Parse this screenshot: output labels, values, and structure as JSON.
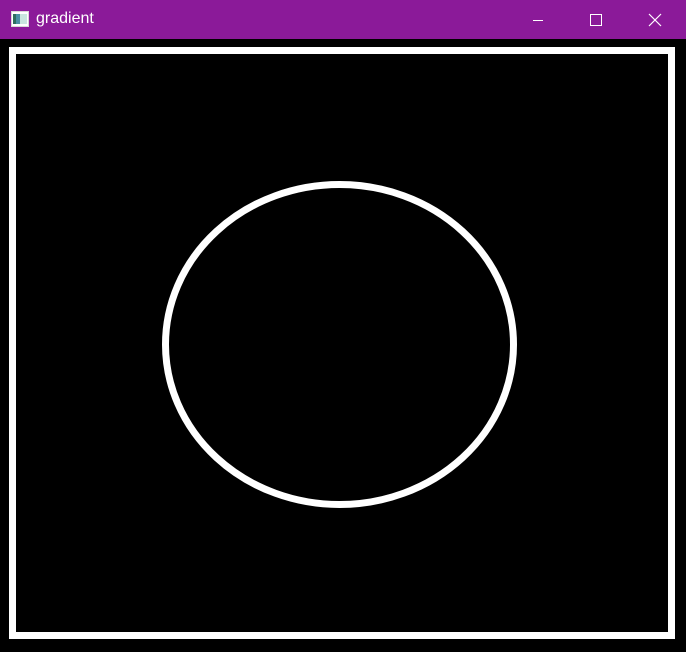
{
  "window": {
    "title": "gradient",
    "icon": "opencv-window-icon",
    "titlebar_color": "#8b1a99",
    "controls": {
      "minimize_icon": "minimize-icon",
      "maximize_icon": "maximize-icon",
      "close_icon": "close-icon"
    }
  },
  "image": {
    "background_color": "#000000",
    "stroke_color": "#ffffff",
    "shapes": [
      "rectangle-outline",
      "circle-outline"
    ]
  }
}
